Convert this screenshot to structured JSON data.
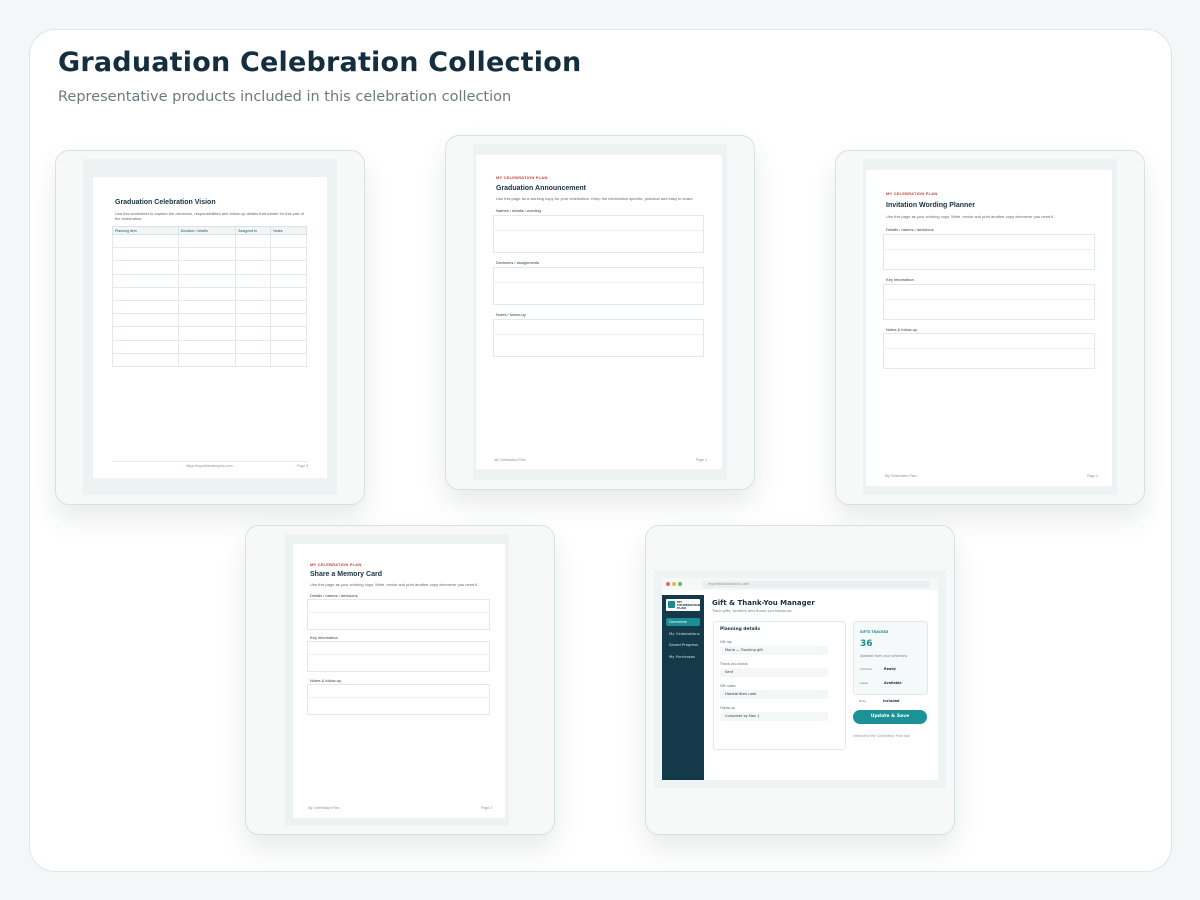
{
  "header": {
    "title": "Graduation Celebration Collection",
    "subtitle": "Representative products included in this celebration collection"
  },
  "products": [
    {
      "title": "Graduation Celebration Vision",
      "description": "Use this worksheet to capture the decisions, responsibilities and follow-up details that matter for this part of the celebration.",
      "columns": [
        "Planning item",
        "Decision / details",
        "Assigned to",
        "Notes"
      ],
      "footer_url": "https://mycelebrationplan.com",
      "footer_page": "Page 3"
    },
    {
      "brand": "MY CELEBRATION PLAN",
      "title": "Graduation Announcement",
      "description": "Use this page as a working copy for your celebration. Keep the information specific, practical and easy to share.",
      "sections": [
        "Names / details / wording",
        "Decisions / assignments",
        "Notes / follow-up"
      ],
      "footer_left": "My Celebration Plan",
      "footer_page": "Page 2"
    },
    {
      "brand": "MY CELEBRATION PLAN",
      "title": "Invitation Wording Planner",
      "description": "Use this page as your working copy. Write, revise and print another copy whenever you need it.",
      "sections": [
        "Details / names / decisions",
        "Key information",
        "Notes & follow-up"
      ],
      "footer_left": "My Celebration Plan",
      "footer_page": "Page 2"
    },
    {
      "brand": "MY CELEBRATION PLAN",
      "title": "Share a Memory Card",
      "description": "Use this page as your working copy. Write, revise and print another copy whenever you need it.",
      "sections": [
        "Details / names / decisions",
        "Key information",
        "Notes & follow-up"
      ],
      "footer_left": "My Celebration Plan",
      "footer_page": "Page 2"
    }
  ],
  "app": {
    "url": "mycelebrationplan.com",
    "logo_text": "MY CELEBRATION PLAN",
    "nav": [
      "Overview",
      "My Celebrations",
      "Saved Progress",
      "My Purchases"
    ],
    "active_nav": "Overview",
    "title": "Gift & Thank-You Manager",
    "subtitle": "Track gifts, senders and thank-you follow-up.",
    "panel_title": "Planning details",
    "fields": [
      {
        "label": "Gift log",
        "value": "Maria — Tracking gift"
      },
      {
        "label": "Thank-you status",
        "value": "Sent"
      },
      {
        "label": "Gift notes",
        "value": "Handwritten note"
      },
      {
        "label": "Follow-up",
        "value": "Complete by Nov 1"
      }
    ],
    "stat": {
      "label": "GIFTS TRACKED",
      "value": "36",
      "description": "Updated from your selections"
    },
    "status_rows": [
      {
        "key": "Address",
        "value": "Ready"
      },
      {
        "key": "Label",
        "value": "Available"
      },
      {
        "key": "Note",
        "value": "Included"
      }
    ],
    "button": "Update & Save",
    "footer": "Interactive My Celebration Plan tool"
  },
  "colors": {
    "background": "#f3f7f7",
    "title": "#132f3f",
    "accent": "#1c9196",
    "brand_red": "#c8423a",
    "sidebar": "#143a4a"
  }
}
